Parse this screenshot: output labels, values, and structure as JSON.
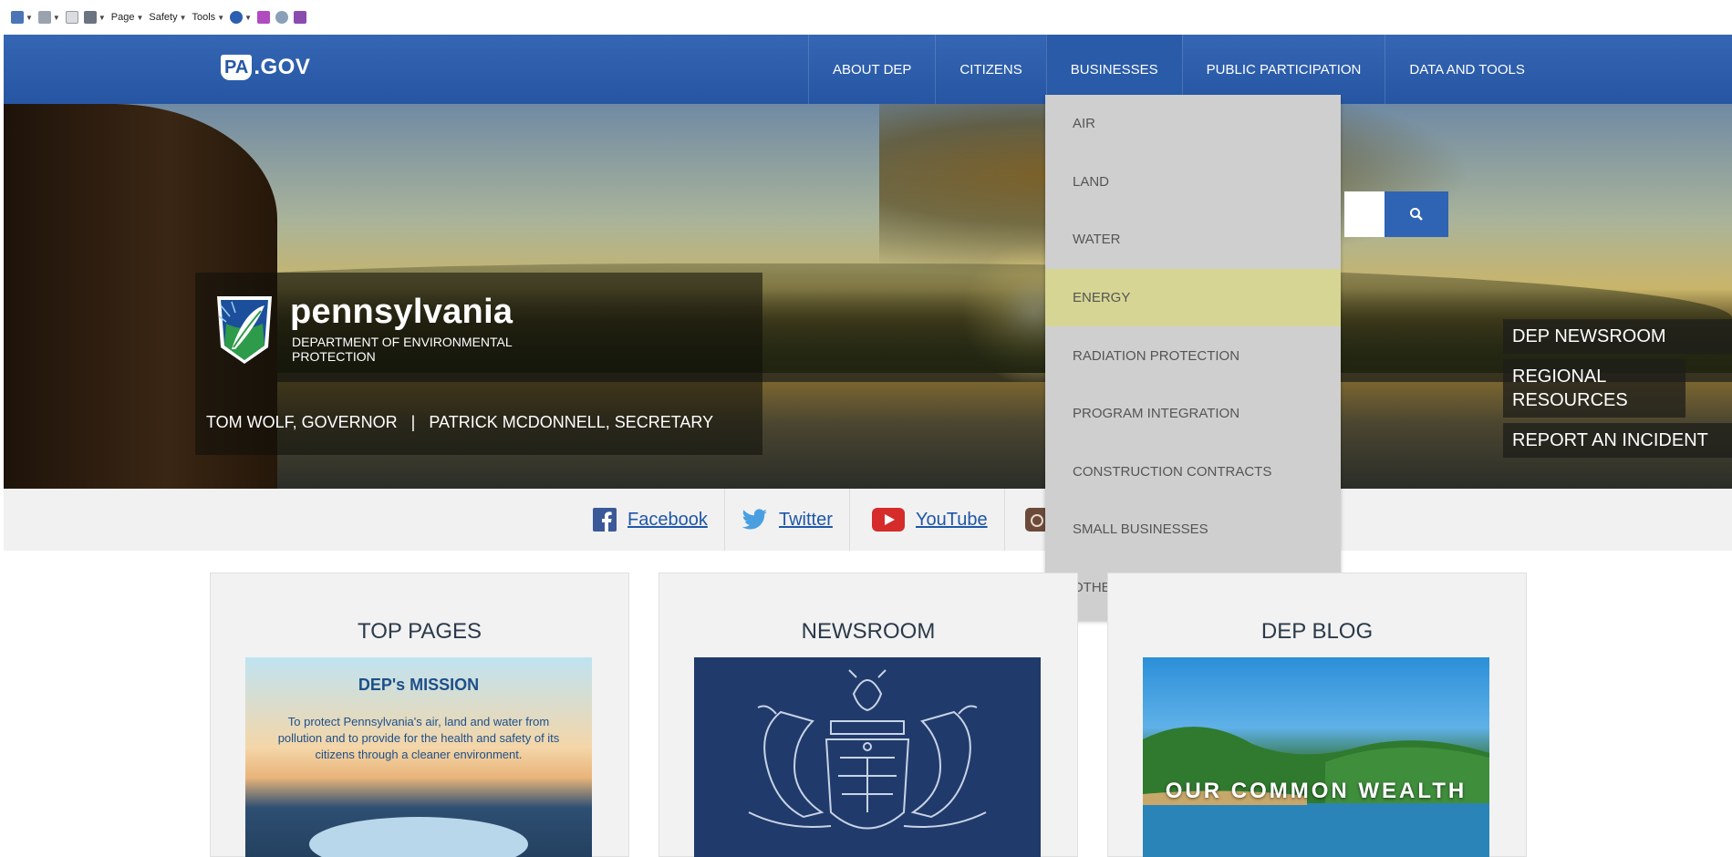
{
  "browser": {
    "command_bar": {
      "page_label": "Page",
      "safety_label": "Safety",
      "tools_label": "Tools"
    }
  },
  "header": {
    "logo_mark": "PA",
    "logo_suffix": ".GOV",
    "nav": [
      {
        "label": "ABOUT DEP"
      },
      {
        "label": "CITIZENS"
      },
      {
        "label": "BUSINESSES"
      },
      {
        "label": "PUBLIC PARTICIPATION"
      },
      {
        "label": "DATA AND TOOLS"
      }
    ]
  },
  "hero": {
    "brand_name": "pennsylvania",
    "department": "DEPARTMENT OF ENVIRONMENTAL PROTECTION",
    "officials": "TOM WOLF, GOVERNOR   |   PATRICK MCDONNELL, SECRETARY",
    "quick_links": [
      "DEP NEWSROOM",
      "REGIONAL RESOURCES",
      "REPORT AN INCIDENT"
    ]
  },
  "dropdown": {
    "items": [
      {
        "label": "AIR"
      },
      {
        "label": "LAND"
      },
      {
        "label": "WATER"
      },
      {
        "label": "ENERGY"
      },
      {
        "label": "RADIATION PROTECTION"
      },
      {
        "label": "PROGRAM INTEGRATION"
      },
      {
        "label": "CONSTRUCTION CONTRACTS"
      },
      {
        "label": "SMALL BUSINESSES"
      },
      {
        "label": "OTHER PROGRAMS"
      }
    ],
    "highlighted": "ENERGY"
  },
  "social": {
    "facebook": "Facebook",
    "twitter": "Twitter",
    "youtube": "YouTube"
  },
  "cards": {
    "top_pages": {
      "title": "TOP PAGES",
      "mission_title": "DEP's MISSION",
      "mission_text": "To protect Pennsylvania's air, land and water from pollution and to provide for the health and safety of its citizens through a cleaner environment."
    },
    "newsroom": {
      "title": "NEWSROOM"
    },
    "blog": {
      "title": "DEP BLOG",
      "image_text": "OUR COMMON WEALTH"
    }
  },
  "colors": {
    "nav_blue": "#2656a3",
    "dropdown_bg": "#cfcfcf",
    "dropdown_highlight": "#d6d593",
    "link_blue": "#1f57a8"
  }
}
